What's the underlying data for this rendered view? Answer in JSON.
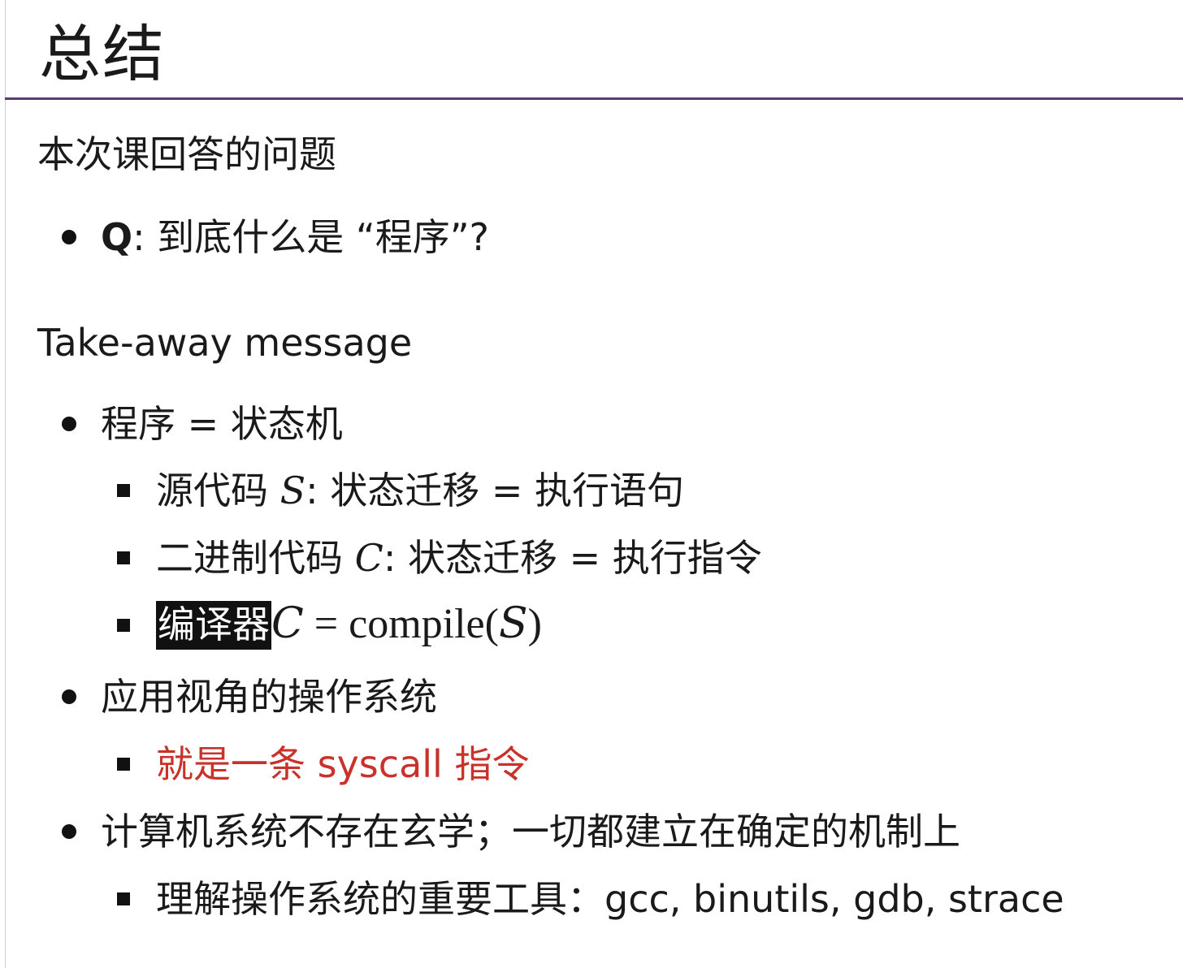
{
  "slide": {
    "title": "总结"
  },
  "section_questions": {
    "heading": "本次课回答的问题",
    "items": [
      {
        "label": "Q",
        "sep": ": ",
        "text": "到底什么是 “程序”?"
      }
    ]
  },
  "section_takeaway": {
    "heading": "Take-away message",
    "items": [
      {
        "text": "程序 = 状态机",
        "subitems": [
          {
            "prefix": "源代码 ",
            "var": "S",
            "suffix": ": 状态迁移 = 执行语句"
          },
          {
            "prefix": "二进制代码 ",
            "var": "C",
            "suffix": ": 状态迁移 = 执行指令"
          },
          {
            "highlight": "编译器",
            "var": "C",
            "op": " = ",
            "func": "compile(",
            "arg": "S",
            "close": ")"
          }
        ]
      },
      {
        "text": "应用视角的操作系统",
        "subitems": [
          {
            "text": "就是一条 syscall 指令"
          }
        ]
      },
      {
        "text": "计算机系统不存在玄学；一切都建立在确定的机制上",
        "subitems": [
          {
            "prefix": "理解操作系统的重要工具：",
            "tools": "gcc, binutils, gdb, strace"
          }
        ]
      }
    ]
  },
  "colors": {
    "title_rule": "#5b3a6e",
    "emphasis_red": "#c8322a",
    "highlight_bg": "#111111"
  }
}
